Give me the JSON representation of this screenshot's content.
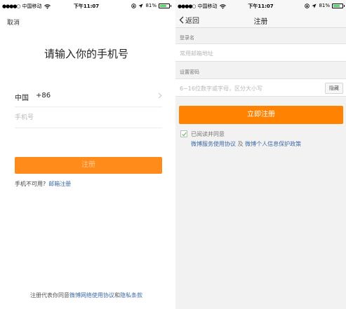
{
  "status_bar": {
    "carrier": "中国移动",
    "time": "下午11:07",
    "battery": "81%",
    "battery_level": 0.81
  },
  "left": {
    "cancel_label": "取消",
    "title": "请输入你的手机号",
    "country_name": "中国",
    "country_code": "+86",
    "phone_placeholder": "手机号",
    "register_label": "注册",
    "no_phone_label": "手机不可用?",
    "email_register_label": "邮箱注册",
    "terms_prefix": "注册代表你同意",
    "terms_link1": "微博网络使用协议",
    "terms_and": "和",
    "terms_link2": "隐私条款"
  },
  "right": {
    "back_label": "返回",
    "nav_title": "注册",
    "login_name_label": "登录名",
    "login_name_placeholder": "常用邮箱地址",
    "password_label": "设置密码",
    "password_placeholder": "6~16位数字或字母，区分大小写",
    "hide_label": "隐藏",
    "register_now_label": "立即注册",
    "agree_text": "已阅读并同意",
    "agree_link1": "微博服务使用协议",
    "agree_and": "及",
    "agree_link2": "微博个人信息保护政策"
  },
  "colors": {
    "accent": "#ff8200",
    "link": "#3d6aa6",
    "checkmark": "#4cb84c"
  },
  "icons": [
    "wifi-icon",
    "location-arrow-icon",
    "lock-rotation-icon",
    "battery-icon",
    "chevron-right-icon",
    "chevron-left-icon",
    "checkmark-icon"
  ]
}
